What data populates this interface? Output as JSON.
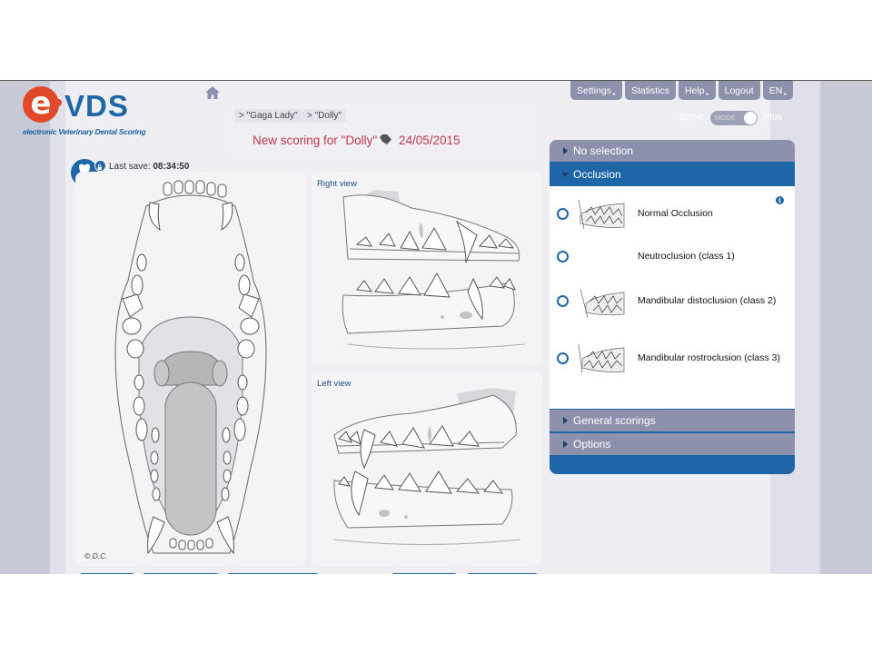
{
  "app": {
    "logo_letter": "e",
    "logo_name": "VDS",
    "logo_subtitle": "electronic Veterinary Dental Scoring"
  },
  "breadcrumbs": [
    "> \"Gaga Lady\"",
    "> \"Dolly\""
  ],
  "scoring": {
    "title": "New scoring for \"Dolly\"",
    "date": "24/05/2015"
  },
  "save": {
    "label": "Last save:",
    "time": "08:34:50"
  },
  "nav": [
    {
      "label": "Settings",
      "arrow": "▸"
    },
    {
      "label": "Statistics",
      "arrow": ""
    },
    {
      "label": "Help",
      "arrow": "▸"
    },
    {
      "label": "Logout",
      "arrow": ""
    },
    {
      "label": "EN",
      "arrow": "▸"
    }
  ],
  "mode": {
    "left": "Basic",
    "toggle_text": "MODE",
    "right": "Plus",
    "selected": "Plus"
  },
  "views": {
    "right_label": "Right view",
    "left_label": "Left view",
    "copyright": "© D.C."
  },
  "panel": {
    "sections": [
      {
        "label": "No selection",
        "open": false
      },
      {
        "label": "Occlusion",
        "open": true
      },
      {
        "label": "General scorings",
        "open": false
      },
      {
        "label": "Options",
        "open": false
      }
    ],
    "info_glyph": "i",
    "occlusion_options": [
      {
        "label": "Normal Occlusion",
        "has_thumb": true
      },
      {
        "label": "Neutroclusion (class 1)",
        "has_thumb": false
      },
      {
        "label": "Mandibular distoclusion (class 2)",
        "has_thumb": true
      },
      {
        "label": "Mandibular rostroclusion (class 3)",
        "has_thumb": true
      }
    ]
  },
  "colors": {
    "brand_blue": "#1e66a8",
    "brand_red": "#e04a2a",
    "title_red": "#c0374d",
    "nav_grey": "#8e91ab"
  }
}
